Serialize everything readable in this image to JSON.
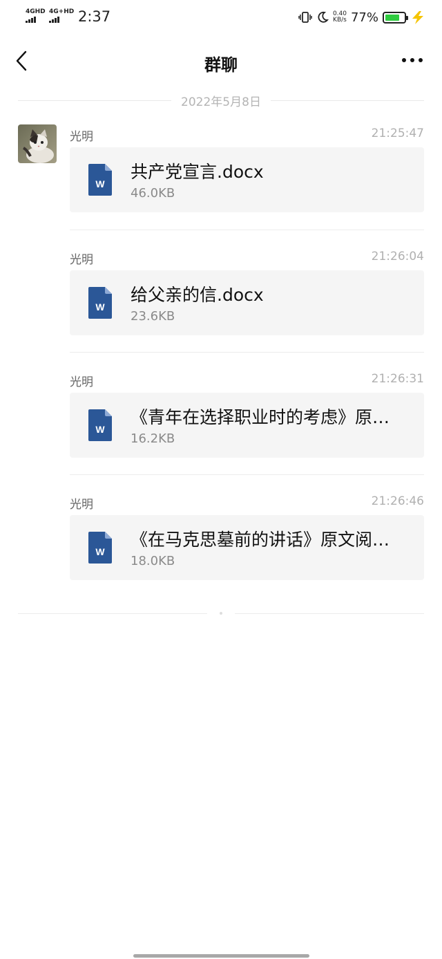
{
  "status_bar": {
    "signal1": "4GHD",
    "signal2": "4G+HD",
    "time": "2:37",
    "speed_value": "0.40",
    "speed_unit": "KB/s",
    "battery_pct": "77%",
    "battery_level": 0.77,
    "icons": [
      "vibrate-icon",
      "moon-icon",
      "charging-bolt-icon"
    ]
  },
  "nav": {
    "title": "群聊"
  },
  "date_separator": "2022年5月8日",
  "colors": {
    "word_blue": "#2b5797",
    "battery_green": "#2ecb3f",
    "bolt_yellow": "#f5c400"
  },
  "messages": [
    {
      "sender": "光明",
      "time": "21:25:47",
      "file_name": "共产党宣言.docx",
      "file_size": "46.0KB"
    },
    {
      "sender": "光明",
      "time": "21:26:04",
      "file_name": "给父亲的信.docx",
      "file_size": "23.6KB"
    },
    {
      "sender": "光明",
      "time": "21:26:31",
      "file_name": "《青年在选择职业时的考虑》原…",
      "file_size": "16.2KB"
    },
    {
      "sender": "光明",
      "time": "21:26:46",
      "file_name": "《在马克思墓前的讲话》原文阅…",
      "file_size": "18.0KB"
    }
  ],
  "file_icon_letter": "W"
}
